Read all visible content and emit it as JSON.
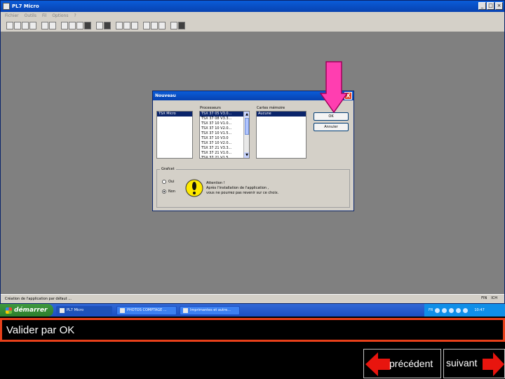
{
  "app": {
    "title": "PL7 Micro",
    "menu": [
      "Fichier",
      "Outils",
      "Fil",
      "Options",
      "?"
    ],
    "status_left": "Création de l'application par défaut ...",
    "status_right": [
      "FIN",
      "ICH"
    ]
  },
  "dialog": {
    "title": "Nouveau",
    "close_label": "X",
    "left_list": {
      "items": [
        "TSX Micro"
      ],
      "selected": 0
    },
    "processors": {
      "label": "Processeurs",
      "items": [
        "TSX 37 05  V3.0...",
        "TSX 37 08  V3.3...",
        "TSX 37 10  V1.0...",
        "TSX 37 10  V2.0...",
        "TSX 37 10  V1.5...",
        "TSX 37 10  V3.0",
        "TSX 37 10  V2.0...",
        "TSX 37 21  V3.3...",
        "TSX 37 21  V1.0...",
        "TSX 37 21  V1.5..."
      ],
      "selected": 0
    },
    "memory_cards": {
      "label": "Cartes mémoire",
      "items": [
        "Aucune"
      ],
      "selected": 0
    },
    "ok_label": "OK",
    "cancel_label": "Annuler",
    "group_label": "Grafcet",
    "radio_yes": "Oui",
    "radio_no": "Non",
    "radio_selected": "no",
    "warning_title": "Attention !",
    "warning_line1": "Après l'installation de l'application ,",
    "warning_line2": "vous ne pourrez pas revenir sur ce choix."
  },
  "taskbar": {
    "start_label": "démarrer",
    "tasks": [
      "PL7 Micro",
      "PHOTOS COMPTAGE ...",
      "Imprimantes et autre..."
    ],
    "lang": "FR",
    "clock": "10:47"
  },
  "caption": "Valider par OK",
  "nav": {
    "prev": "précédent",
    "next": "suivant"
  },
  "colors": {
    "accent_arrow": "#ff3eb0",
    "nav_arrow": "#e8150e",
    "caption_border": "#e8401a"
  }
}
